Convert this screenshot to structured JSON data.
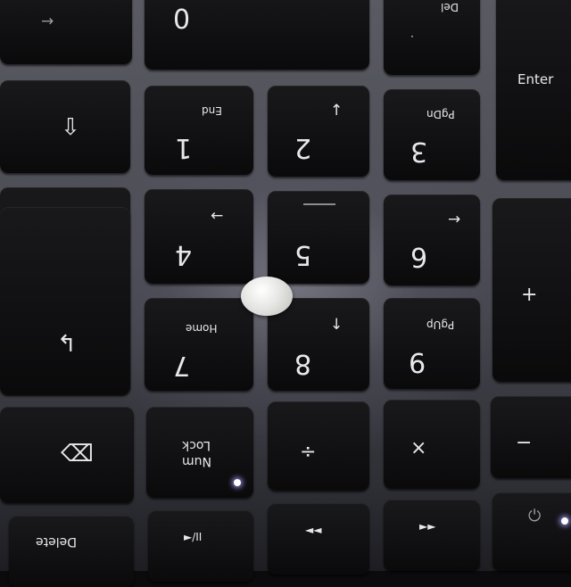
{
  "keys": {
    "zero": "0",
    "del": "Del",
    "del_dot": ".",
    "enter": "Enter",
    "one": "1",
    "end": "End",
    "two": "2",
    "three": "3",
    "pgdn": "PgDn",
    "four": "4",
    "five": "5",
    "six": "6",
    "plus": "+",
    "seven": "7",
    "home": "Home",
    "eight": "8",
    "nine": "9",
    "pgup": "PgUp",
    "lock": "Lock",
    "num": "Num",
    "divide": "÷",
    "multiply": "×",
    "minus": "−",
    "delete": "Delete",
    "play_pause": "►/II",
    "prev_track": "◄◄",
    "next_track": "►►"
  },
  "icons": {
    "arrow_right": "→",
    "arrow_up": "↑",
    "arrow_left": "←",
    "arrow_down": "↓",
    "shift": "⇩",
    "backspace": "⌫",
    "power": "⏻"
  }
}
